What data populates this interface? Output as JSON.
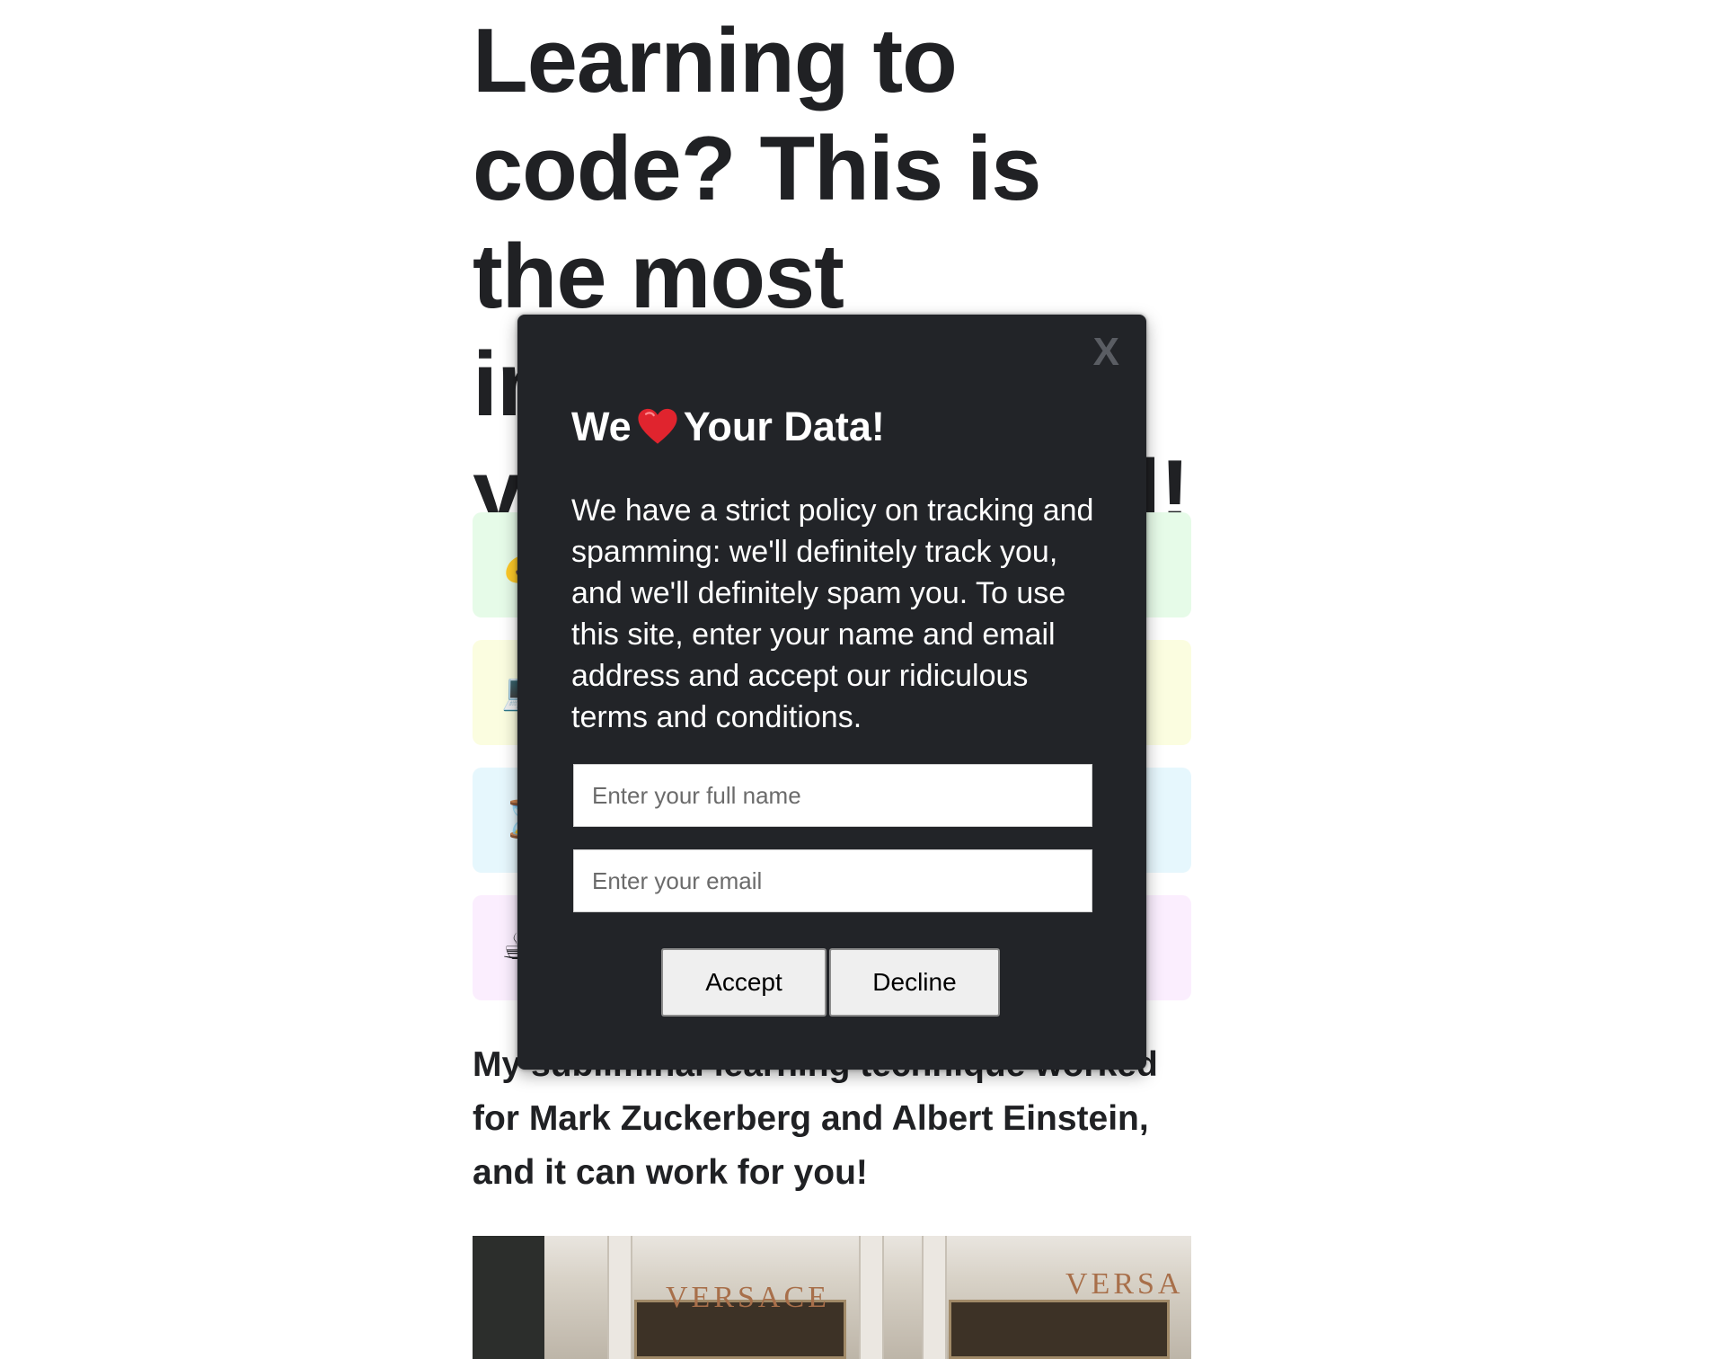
{
  "page": {
    "headline": "Learning to code? This is the most important thing you should read!",
    "subline": "My subliminal learning technique worked for Mark Zuckerberg and Albert Einstein, and it can work for you!"
  },
  "features": [
    {
      "emoji": "💰",
      "color": "#e6fbe8"
    },
    {
      "emoji": "💻",
      "color": "#fbfde0"
    },
    {
      "emoji": "⌛",
      "color": "#e6f7fd"
    },
    {
      "emoji": "☕",
      "color": "#fbeefe"
    }
  ],
  "hero_image": {
    "sign_left": "VERSACE",
    "sign_right": "VERSA"
  },
  "modal": {
    "close_label": "X",
    "title_before": "We",
    "title_icon": "heart-icon",
    "title_after": "Your Data!",
    "body": "We have a strict policy on tracking and spamming: we'll definitely track you, and we'll definitely spam you. To use this site, enter your name and email address and accept our ridiculous terms and conditions.",
    "name_placeholder": "Enter your full name",
    "name_value": "",
    "email_placeholder": "Enter your email",
    "email_value": "",
    "accept_label": "Accept",
    "decline_label": "Decline",
    "background": "#222428"
  }
}
